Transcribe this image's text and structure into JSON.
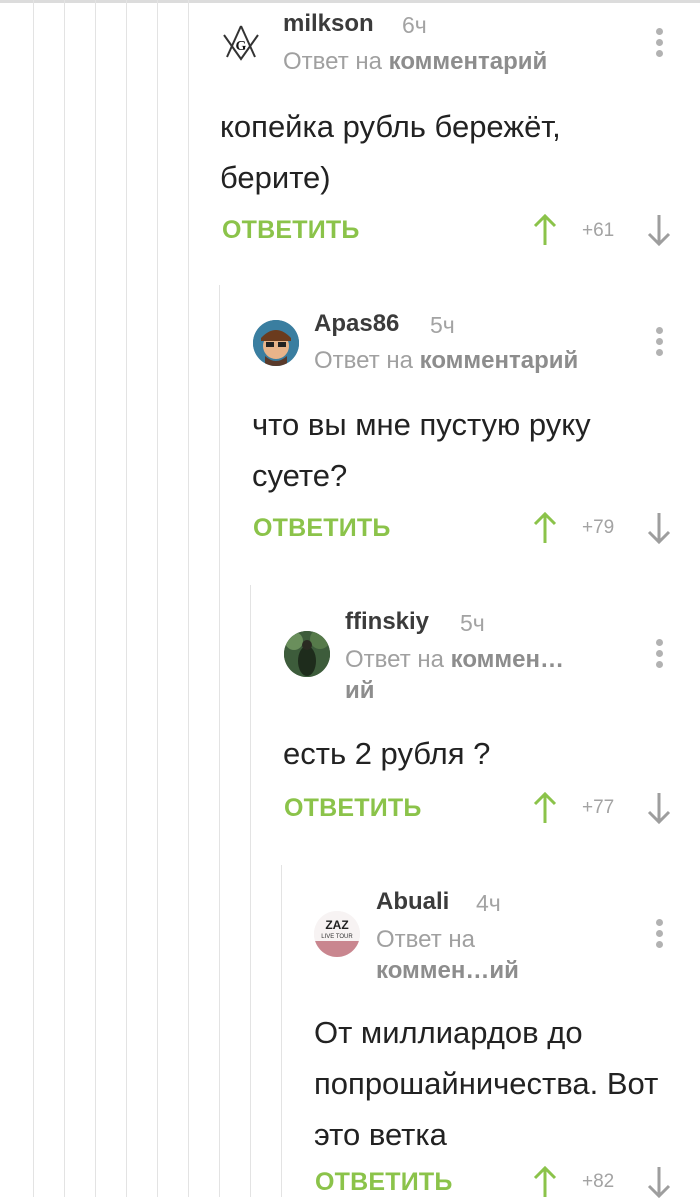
{
  "comments": [
    {
      "username": "milkson",
      "time": "6ч",
      "reply_prefix": "Ответ на",
      "reply_link": "комментарий",
      "reply_link_tail": "",
      "text": "копейка рубль бережёт, берите)",
      "reply_label": "ОТВЕТИТЬ",
      "score": "+61"
    },
    {
      "username": "Apas86",
      "time": "5ч",
      "reply_prefix": "Ответ на",
      "reply_link": "комментарий",
      "reply_link_tail": "",
      "text": "что вы мне пустую руку суете?",
      "reply_label": "ОТВЕТИТЬ",
      "score": "+79"
    },
    {
      "username": "ffinskiy",
      "time": "5ч",
      "reply_prefix": "Ответ на",
      "reply_link": "коммен…",
      "reply_link_tail": "ий",
      "text": "есть 2 рубля ?",
      "reply_label": "ОТВЕТИТЬ",
      "score": "+77"
    },
    {
      "username": "Abuali",
      "time": "4ч",
      "reply_prefix": "Ответ на",
      "reply_link": "коммен…ий",
      "reply_link_tail": "",
      "text": "От миллиардов до попрошайничества. Вот это ветка",
      "reply_label": "ОТВЕТИТЬ",
      "score": "+82",
      "avatar_text": "ZAZ",
      "avatar_subtext": "LIVE TOUR"
    }
  ],
  "colors": {
    "accent": "#8bc34a",
    "muted": "#a3a3a3",
    "thread_line": "#e3e3e3"
  },
  "icons": {
    "upvote": "arrow-up-icon",
    "downvote": "arrow-down-icon",
    "menu": "more-vertical-icon"
  }
}
